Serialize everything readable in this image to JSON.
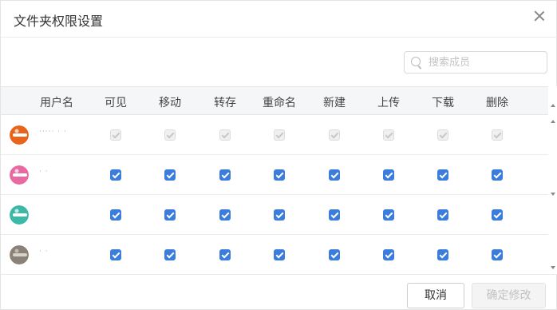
{
  "dialog": {
    "title": "文件夹权限设置",
    "close_icon": "close-icon"
  },
  "search": {
    "placeholder": "搜索成员",
    "value": "",
    "icon": "search-icon"
  },
  "table": {
    "columns": [
      "用户名",
      "可见",
      "移动",
      "转存",
      "重命名",
      "新建",
      "上传",
      "下载",
      "删除"
    ],
    "rows": [
      {
        "username": "·····  ·  ·",
        "avatar_colors": [
          "#e8641a",
          "#ffffff"
        ],
        "permissions": [
          true,
          true,
          true,
          true,
          true,
          true,
          true,
          true
        ],
        "disabled": true
      },
      {
        "username": "·  ·",
        "avatar_colors": [
          "#e86aa0",
          "#ffffff"
        ],
        "permissions": [
          true,
          true,
          true,
          true,
          true,
          true,
          true,
          true
        ],
        "disabled": false
      },
      {
        "username": "",
        "avatar_colors": [
          "#3bb8a6",
          "#ffffff"
        ],
        "permissions": [
          true,
          true,
          true,
          true,
          true,
          true,
          true,
          true
        ],
        "disabled": false
      },
      {
        "username": "·  ·",
        "avatar_colors": [
          "#8a8178",
          "#d8d2c8"
        ],
        "permissions": [
          true,
          true,
          true,
          true,
          true,
          true,
          true,
          true
        ],
        "disabled": false
      }
    ]
  },
  "footer": {
    "cancel_label": "取消",
    "confirm_label": "确定修改"
  },
  "colors": {
    "checkbox_checked": "#3b7ddd",
    "checkbox_disabled": "#f0f0f0",
    "header_bg": "#f5f6f7"
  }
}
